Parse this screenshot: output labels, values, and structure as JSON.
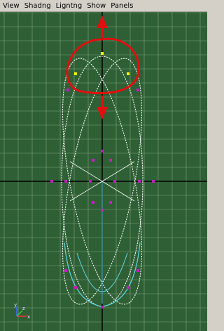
{
  "menubar": {
    "items": [
      {
        "label": "View"
      },
      {
        "label": "Shadng"
      },
      {
        "label": "Ligntng"
      },
      {
        "label": "Show"
      },
      {
        "label": "Panels"
      }
    ]
  },
  "viewport": {
    "background": "#2f5f35",
    "grid_color": "#7fa37f",
    "axis_color": "#000000",
    "curve_white": "#ffffff",
    "curve_cyan": "#5fd0d8",
    "cv_color": "#c020c0",
    "selected_cv_color": "#ffff00",
    "annotation_color": "#e01010",
    "axis_gizmo": {
      "x_label": "x",
      "y_label": "y",
      "z_label": "z"
    }
  }
}
